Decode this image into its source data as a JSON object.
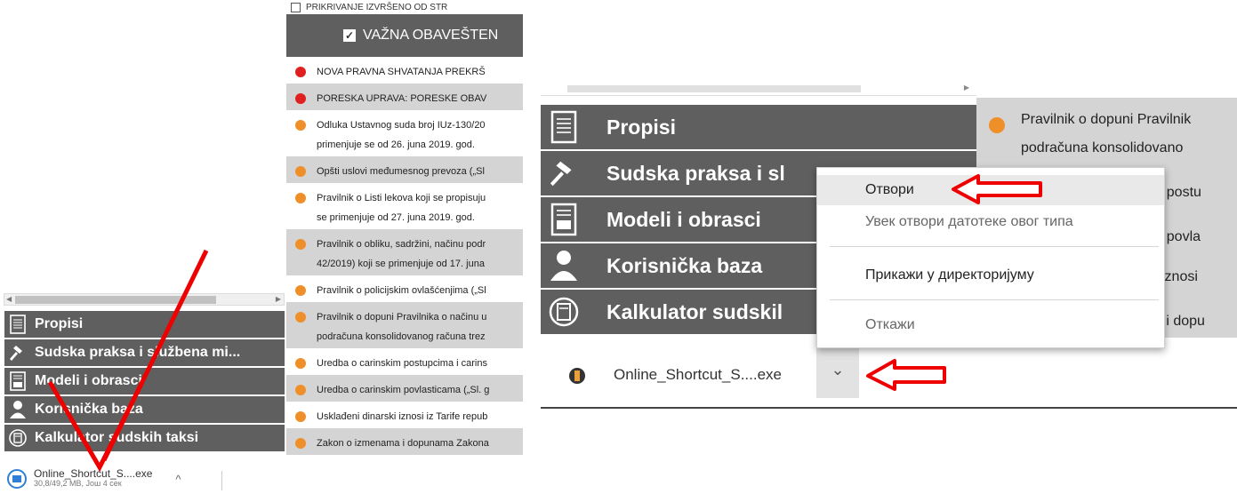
{
  "colors": {
    "menu_bg": "#5f5f5f",
    "dot_red": "#e02020",
    "dot_orange": "#ef8f2a",
    "highlight_row": "#d4d4d4",
    "annotation_red": "#ee0000",
    "download_blue": "#2f7fd6"
  },
  "left_panel": {
    "menu": [
      {
        "label": "Propisi",
        "icon": "document-icon"
      },
      {
        "label": "Sudska praksa i službena mi...",
        "icon": "gavel-icon"
      },
      {
        "label": "Modeli i obrasci",
        "icon": "form-icon"
      },
      {
        "label": "Korisnička baza",
        "icon": "user-icon"
      },
      {
        "label": "Kalkulator sudskih taksi",
        "icon": "calculator-icon"
      }
    ],
    "download": {
      "file_name": "Online_Shortcut_S....exe",
      "progress_text": "30,8/49,2 MB, Још 4 сек",
      "icon": "file-icon",
      "chevron": "^"
    }
  },
  "middle_panel": {
    "top_item": "PRIKRIVANJE IZVRŠENO OD STR",
    "header_label": "VAŽNA OBAVEŠTEN",
    "header_check": "✓",
    "news": [
      {
        "line1": "NOVA PRAVNA SHVATANJA PREKRŠ",
        "line2": "",
        "dot": "red",
        "grey": false
      },
      {
        "line1": "PORESKA UPRAVA: PORESKE OBAV",
        "line2": "",
        "dot": "red",
        "grey": true
      },
      {
        "line1": "Odluka Ustavnog suda broj IUz-130/20",
        "line2": "primenjuje se od 26. juna 2019. god.",
        "dot": "orange",
        "grey": false
      },
      {
        "line1": "Opšti uslovi međumesnog prevoza („Sl",
        "line2": "",
        "dot": "orange",
        "grey": true
      },
      {
        "line1": "Pravilnik o Listi lekova koji se propisuju",
        "line2": "se primenjuje od 27. juna 2019. god.",
        "dot": "orange",
        "grey": false
      },
      {
        "line1": "Pravilnik o obliku, sadržini, načinu podr",
        "line2": "42/2019) koji se primenjuje od 17. juna",
        "dot": "orange",
        "grey": true
      },
      {
        "line1": "Pravilnik o policijskim ovlašćenjima („Sl",
        "line2": "",
        "dot": "orange",
        "grey": false
      },
      {
        "line1": "Pravilnik o dopuni Pravilnika o načinu u",
        "line2": "podračuna konsolidovanog računa trez",
        "dot": "orange",
        "grey": true
      },
      {
        "line1": "Uredba o carinskim postupcima i carins",
        "line2": "",
        "dot": "orange",
        "grey": false
      },
      {
        "line1": "Uredba o carinskim povlasticama („Sl. g",
        "line2": "",
        "dot": "orange",
        "grey": true
      },
      {
        "line1": "Usklađeni dinarski iznosi iz Tarife repub",
        "line2": "",
        "dot": "orange",
        "grey": false
      },
      {
        "line1": "Zakon o izmenama i dopunama Zakona",
        "line2": "",
        "dot": "orange",
        "grey": true
      }
    ]
  },
  "right_panel": {
    "menu": [
      {
        "label": "Propisi",
        "icon": "document-icon"
      },
      {
        "label": "Sudska praksa i sl",
        "icon": "gavel-icon"
      },
      {
        "label": "Modeli i obrasci",
        "icon": "form-icon"
      },
      {
        "label": "Korisnička baza",
        "icon": "user-icon"
      },
      {
        "label": "Kalkulator sudskil",
        "icon": "calculator-icon"
      }
    ],
    "news_lines": [
      "Pravilnik o dopuni Pravilnik",
      "podračuna konsolidovano",
      "m postu",
      "m povla",
      "i iznosi",
      "a i dopu"
    ],
    "download": {
      "file_name": "Online_Shortcut_S....exe",
      "chevron": "⌄"
    },
    "context_menu": {
      "open": "Отвори",
      "always_open": "Увек отвори датотеке овог типа",
      "show_in_folder": "Прикажи у директоријуму",
      "cancel": "Откажи"
    }
  }
}
